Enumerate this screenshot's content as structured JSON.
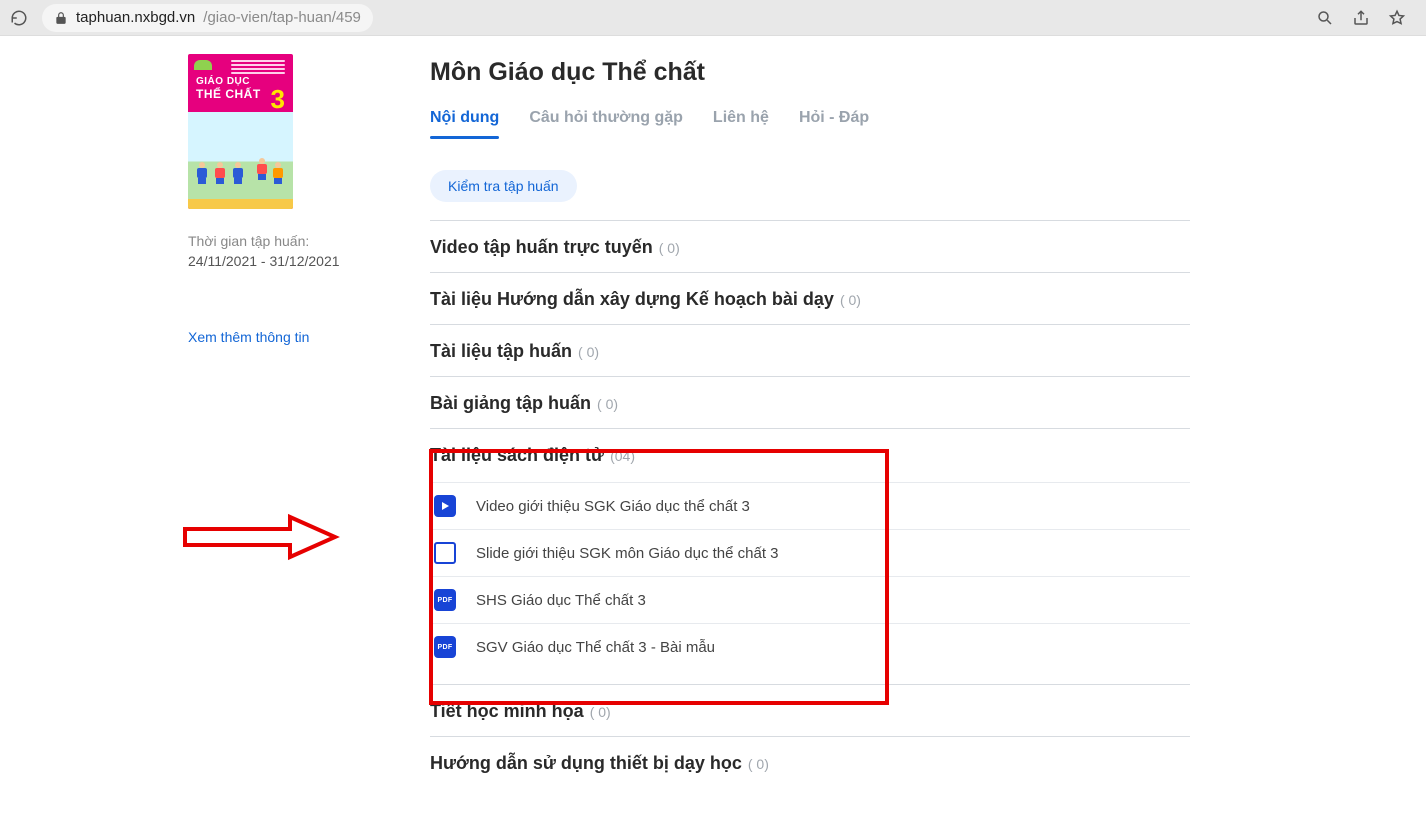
{
  "browser": {
    "url_host": "taphuan.nxbgd.vn",
    "url_path": "/giao-vien/tap-huan/459"
  },
  "sidebar": {
    "book_title_line1": "GIÁO DỤC",
    "book_title_line2": "THỂ CHẤT",
    "book_grade": "3",
    "time_label": "Thời gian tập huấn:",
    "time_range": "24/11/2021 - 31/12/2021",
    "more_info": "Xem thêm thông tin"
  },
  "main": {
    "title": "Môn Giáo dục Thể chất",
    "tabs": [
      {
        "label": "Nội dung",
        "active": true
      },
      {
        "label": "Câu hỏi thường gặp",
        "active": false
      },
      {
        "label": "Liên hệ",
        "active": false
      },
      {
        "label": "Hỏi - Đáp",
        "active": false
      }
    ],
    "test_button": "Kiểm tra tập huấn",
    "sections": [
      {
        "title": "Video tập huấn trực tuyến",
        "count": "( 0)",
        "items": []
      },
      {
        "title": "Tài liệu Hướng dẫn xây dựng Kế hoạch bài dạy",
        "count": "( 0)",
        "items": []
      },
      {
        "title": "Tài liệu tập huấn",
        "count": "( 0)",
        "items": []
      },
      {
        "title": "Bài giảng tập huấn",
        "count": "( 0)",
        "items": []
      },
      {
        "title": "Tài liệu sách điện tử",
        "count": "(04)",
        "items": [
          {
            "icon": "video",
            "label": "Video giới thiệu SGK Giáo dục thể chất 3"
          },
          {
            "icon": "slide",
            "label": "Slide giới thiệu SGK môn Giáo dục thể chất 3"
          },
          {
            "icon": "pdf",
            "label": "SHS Giáo dục Thể chất 3"
          },
          {
            "icon": "pdf",
            "label": "SGV Giáo dục Thể chất 3 - Bài mẫu"
          }
        ]
      },
      {
        "title": "Tiết học minh họa",
        "count": "( 0)",
        "items": []
      },
      {
        "title": "Hướng dẫn sử dụng thiết bị dạy học",
        "count": "( 0)",
        "items": []
      }
    ]
  }
}
